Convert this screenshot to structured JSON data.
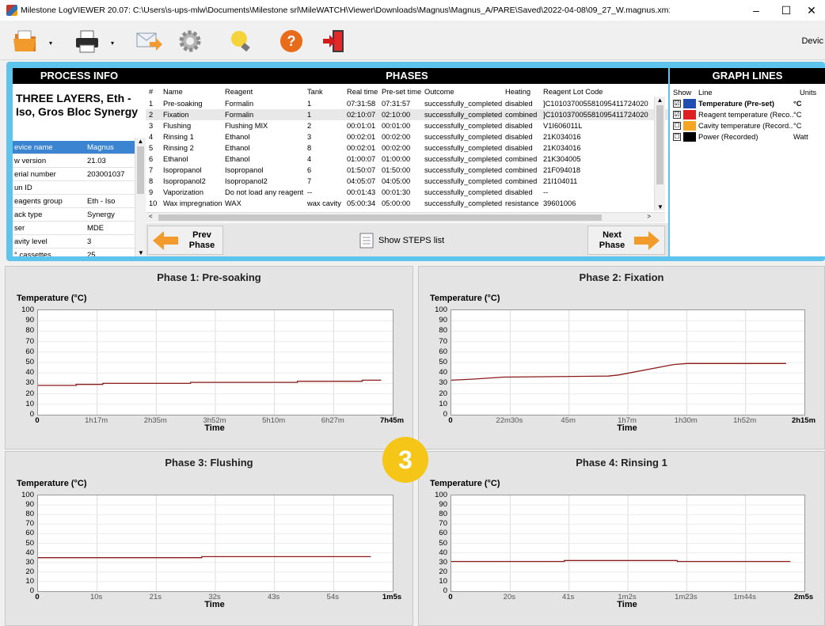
{
  "window": {
    "title": "Milestone LogVIEWER 20.07: C:\\Users\\s-ups-mlw\\Documents\\Milestone srl\\MileWATCH\\Viewer\\Downloads\\Magnus\\Magnus_A/PARE\\Saved\\2022-04-08\\09_27_W.magnus.xm1",
    "minimize": "–",
    "maximize": "☐",
    "close": "✕"
  },
  "toolbar": {
    "device_label": "Devic"
  },
  "process_info": {
    "header": "PROCESS INFO",
    "title": "THREE LAYERS, Eth - Iso, Gros Bloc Synergy",
    "rows": [
      {
        "key": "evice name",
        "value": "Magnus"
      },
      {
        "key": "w version",
        "value": "21.03"
      },
      {
        "key": "erial number",
        "value": "203001037"
      },
      {
        "key": "un ID",
        "value": ""
      },
      {
        "key": "eagents group",
        "value": "Eth - Iso"
      },
      {
        "key": "ack type",
        "value": "Synergy"
      },
      {
        "key": "ser",
        "value": "MDE"
      },
      {
        "key": "avity level",
        "value": "3"
      },
      {
        "key": "° cassettes",
        "value": "25"
      }
    ]
  },
  "phases": {
    "header": "PHASES",
    "columns": [
      "#",
      "Name",
      "Reagent",
      "Tank",
      "Real time",
      "Pre-set time",
      "Outcome",
      "Heating",
      "Reagent Lot Code"
    ],
    "rows": [
      [
        "1",
        "Pre-soaking",
        "Formalin",
        "1",
        "07:31:58",
        "07:31:57",
        "successfully_completed",
        "disabled",
        "]C101037005581095411724020"
      ],
      [
        "2",
        "Fixation",
        "Formalin",
        "1",
        "02:10:07",
        "02:10:00",
        "successfully_completed",
        "combined",
        "]C101037005581095411724020"
      ],
      [
        "3",
        "Flushing",
        "Flushing MIX",
        "2",
        "00:01:01",
        "00:01:00",
        "successfully_completed",
        "disabled",
        "V1I606011L"
      ],
      [
        "4",
        "Rinsing 1",
        "Ethanol",
        "3",
        "00:02:01",
        "00:02:00",
        "successfully_completed",
        "disabled",
        "21K034016"
      ],
      [
        "5",
        "Rinsing 2",
        "Ethanol",
        "8",
        "00:02:01",
        "00:02:00",
        "successfully_completed",
        "disabled",
        "21K034016"
      ],
      [
        "6",
        "Ethanol",
        "Ethanol",
        "4",
        "01:00:07",
        "01:00:00",
        "successfully_completed",
        "combined",
        "21K304005"
      ],
      [
        "7",
        "Isopropanol",
        "Isopropanol",
        "6",
        "01:50:07",
        "01:50:00",
        "successfully_completed",
        "combined",
        "21F094018"
      ],
      [
        "8",
        "Isopropanol2",
        "Isopropanol2",
        "7",
        "04:05:07",
        "04:05:00",
        "successfully_completed",
        "combined",
        "21I104011"
      ],
      [
        "9",
        "Vaporization",
        "Do not load any reagent",
        "--",
        "00:01:43",
        "00:01:30",
        "successfully_completed",
        "disabled",
        "--"
      ],
      [
        "10",
        "Wax impregnation",
        "WAX",
        "wax cavity",
        "05:00:34",
        "05:00:00",
        "successfully_completed",
        "resistance",
        "39601006"
      ]
    ],
    "prev_label": "Prev Phase",
    "next_label": "Next Phase",
    "steps_label": "Show STEPS list"
  },
  "graph_lines": {
    "header": "GRAPH LINES",
    "columns": [
      "Show",
      "Line",
      "Units"
    ],
    "rows": [
      {
        "checked": "☑",
        "color": "#1f4fb3",
        "line": "Temperature (Pre-set)",
        "unit": "°C",
        "bold": true
      },
      {
        "checked": "☑",
        "color": "#e02020",
        "line": "Reagent temperature (Reco...",
        "unit": "°C",
        "bold": false
      },
      {
        "checked": "☐",
        "color": "#f5a623",
        "line": "Cavity temperature (Record...",
        "unit": "°C",
        "bold": false
      },
      {
        "checked": "☐",
        "color": "#000000",
        "line": "Power (Recorded)",
        "unit": "Watt",
        "bold": false
      }
    ]
  },
  "badge": "3",
  "chart_data": [
    {
      "type": "line",
      "title": "Phase 1: Pre-soaking",
      "ylabel": "Temperature (°C)",
      "xlabel": "Time",
      "ylim": [
        0,
        100
      ],
      "yticks": [
        "0",
        "10",
        "20",
        "30",
        "40",
        "50",
        "60",
        "70",
        "80",
        "90",
        "100"
      ],
      "xticks": [
        "0",
        "1h17m",
        "2h35m",
        "3h52m",
        "5h10m",
        "6h27m",
        "7h45m"
      ],
      "xmax": 465,
      "series": [
        {
          "color": "#8b1a1a",
          "x": [
            0,
            50,
            50,
            85,
            85,
            200,
            200,
            340,
            340,
            425,
            425,
            450
          ],
          "y": [
            28,
            28,
            29,
            29,
            30,
            30,
            31,
            31,
            32,
            32,
            33,
            33
          ]
        }
      ]
    },
    {
      "type": "line",
      "title": "Phase 2: Fixation",
      "ylabel": "Temperature (°C)",
      "xlabel": "Time",
      "ylim": [
        0,
        100
      ],
      "yticks": [
        "0",
        "10",
        "20",
        "30",
        "40",
        "50",
        "60",
        "70",
        "80",
        "90",
        "100"
      ],
      "xticks": [
        "0",
        "22m30s",
        "45m",
        "1h7m",
        "1h30m",
        "1h52m",
        "2h15m"
      ],
      "xmax": 135,
      "series": [
        {
          "color": "#8b1a1a",
          "x": [
            0,
            8,
            20,
            60,
            64,
            85,
            90,
            128
          ],
          "y": [
            33,
            34,
            36,
            37,
            38,
            48,
            49,
            49
          ]
        }
      ]
    },
    {
      "type": "line",
      "title": "Phase 3: Flushing",
      "ylabel": "Temperature (°C)",
      "xlabel": "Time",
      "ylim": [
        0,
        100
      ],
      "yticks": [
        "0",
        "10",
        "20",
        "30",
        "40",
        "50",
        "60",
        "70",
        "80",
        "90",
        "100"
      ],
      "xticks": [
        "0",
        "10s",
        "21s",
        "32s",
        "43s",
        "54s",
        "1m5s"
      ],
      "xmax": 65,
      "series": [
        {
          "color": "#8b1a1a",
          "x": [
            0,
            30,
            30,
            61
          ],
          "y": [
            35,
            35,
            36,
            36
          ]
        }
      ]
    },
    {
      "type": "line",
      "title": "Phase 4: Rinsing 1",
      "ylabel": "Temperature (°C)",
      "xlabel": "Time",
      "ylim": [
        0,
        100
      ],
      "yticks": [
        "0",
        "10",
        "20",
        "30",
        "40",
        "50",
        "60",
        "70",
        "80",
        "90",
        "100"
      ],
      "xticks": [
        "0",
        "20s",
        "41s",
        "1m2s",
        "1m23s",
        "1m44s",
        "2m5s"
      ],
      "xmax": 125,
      "series": [
        {
          "color": "#8b1a1a",
          "x": [
            0,
            40,
            40,
            80,
            80,
            120
          ],
          "y": [
            31,
            31,
            32,
            32,
            31,
            31
          ]
        }
      ]
    }
  ]
}
